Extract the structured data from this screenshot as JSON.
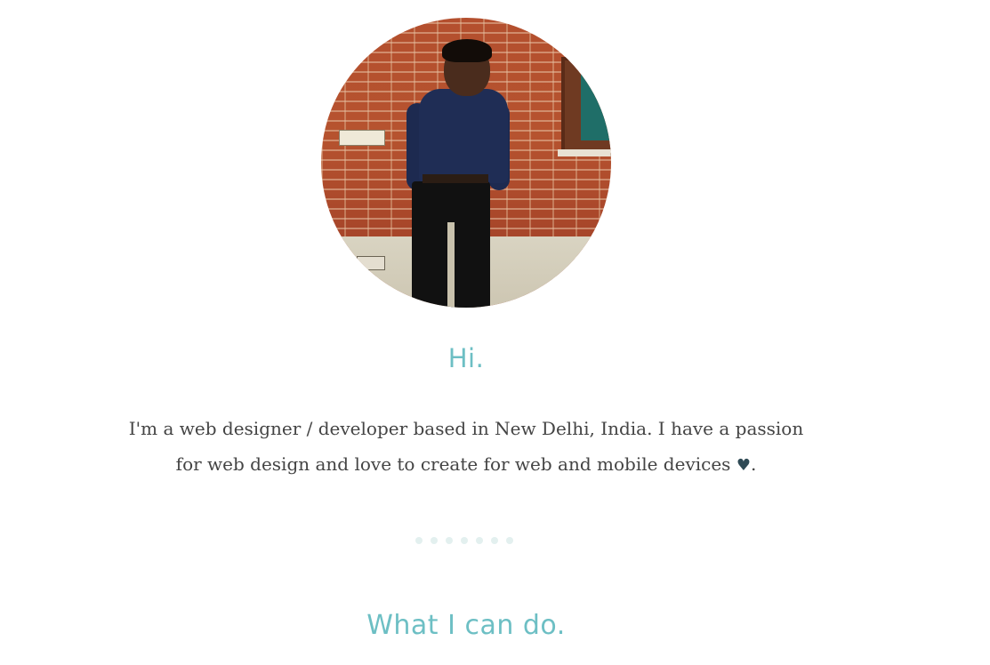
{
  "hero": {
    "avatar": {
      "description_icon": "profile-photo"
    },
    "greeting": "Hi.",
    "intro_text": "I'm a web designer / developer based in New Delhi, India. I have a passion for web design and love to create for web and mobile devices",
    "intro_heart_icon": "heart-icon",
    "intro_heart_glyph": "♥",
    "intro_end": "."
  },
  "divider": {
    "dot_count": 7
  },
  "skills": {
    "title": "What I can do."
  },
  "colors": {
    "accent": "#6dbfc4",
    "body_text": "#444444",
    "heart": "#2f4a55",
    "dots": "#e3f0ef"
  }
}
